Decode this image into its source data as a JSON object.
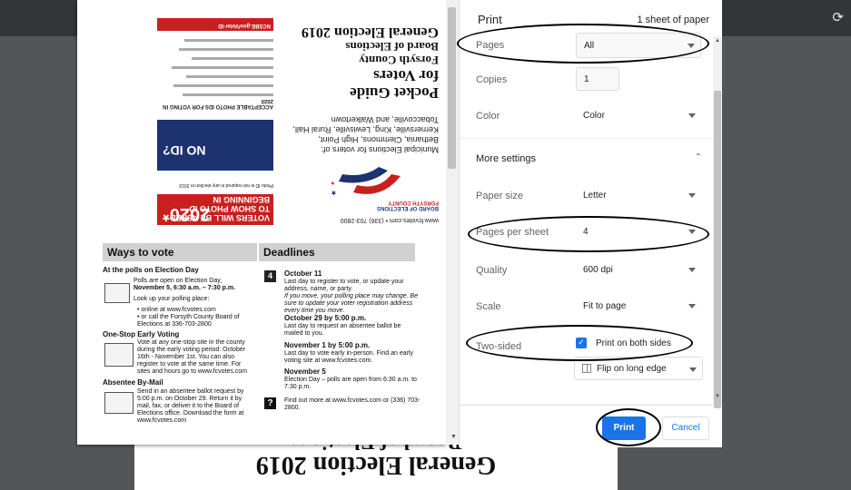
{
  "toolbar": {
    "reload_icon": "⟳"
  },
  "background_page": {
    "line1": "General Election 2019",
    "line2": "Board of Elections"
  },
  "preview": {
    "website": "www.fcvotes.com • (336) 703-2800",
    "board_label": "BOARD OF ELECTIONS",
    "county_label": "FORSYTH COUNTY",
    "municipal": "Municipal Elections for voters of: Bethania, Clemmons, High Point, Kernersville, King, Lewisville, Rural Hall, Tobaccoville, and Walkertown",
    "general_election": "General Election 2019",
    "board": "Board of Elections",
    "forsyth": "Forsyth County",
    "for_voters": "for Voters",
    "pocket_guide": "Pocket Guide",
    "red_banner": "VOTERS WILL BE ASKED TO SHOW PHOTO ID BEGINNING IN",
    "red_year": "2020*",
    "photo_note": "Photo ID is not required in any election in 2019",
    "no_id": "NO ID?",
    "acceptable": "ACCEPTABLE PHOTO IDS FOR VOTING IN 2020",
    "ncsbe": "NCSBE.gov/Voter-ID",
    "ways_header": "Ways to vote",
    "deadlines_header": "Deadlines",
    "polls_title": "At the polls on Election Day",
    "polls_open": "Polls are open on Election Day,",
    "polls_time": "November 5, 6:30 a.m. – 7:30 p.m.",
    "lookup": "Look up your polling place:",
    "online": "• online at www.fcvotes.com",
    "call": "• or call the Forsyth County Board of Elections at 336-703-2800",
    "onestop_title": "One-Stop Early Voting",
    "onestop_text": "Vote at any one-stop site in the county during the early voting period: October 16th - November 1st. You can also register to vote at the same time. For sites and hours go to www.fcvotes.com",
    "absentee_title": "Absentee By-Mail",
    "absentee_text": "Send in an absentee ballot request by 5:00 p.m. on October 29. Return it by mail, fax, or deliver it to the Board of Elections office. Download the form at www.fcvotes.com",
    "cal_num": "4",
    "oct11": "October 11",
    "oct11_text": "Last day to register to vote, or update your address, name, or party.",
    "oct11_italic": "If you move, your polling place may change. Be sure to update your voter registration address every time you move.",
    "oct29": "October 29 by 5:00 p.m.",
    "oct29_text": "Last day to request an absentee ballot be mailed to you.",
    "nov1": "November 1 by 5:00 p.m.",
    "nov1_text": "Last day to vote early in-person. Find an early voting site at www.fcvotes.com.",
    "nov5": "November 5",
    "nov5_text": "Election Day – polls are open from 6:30 a.m. to 7:30 p.m.",
    "qmark": "?",
    "findout": "Find out more at www.fcvotes.com or (336) 703-2800."
  },
  "print_panel": {
    "title": "Print",
    "sheets": "1 sheet of paper",
    "pages_label": "Pages",
    "pages_value": "All",
    "copies_label": "Copies",
    "copies_value": "1",
    "color_label": "Color",
    "color_value": "Color",
    "more_settings": "More settings",
    "paper_size_label": "Paper size",
    "paper_size_value": "Letter",
    "pps_label": "Pages per sheet",
    "pps_value": "4",
    "quality_label": "Quality",
    "quality_value": "600 dpi",
    "scale_label": "Scale",
    "scale_value": "Fit to page",
    "two_sided_label": "Two-sided",
    "two_sided_check": "Print on both sides",
    "flip_value": "Flip on long edge",
    "print_button": "Print",
    "cancel_button": "Cancel"
  }
}
